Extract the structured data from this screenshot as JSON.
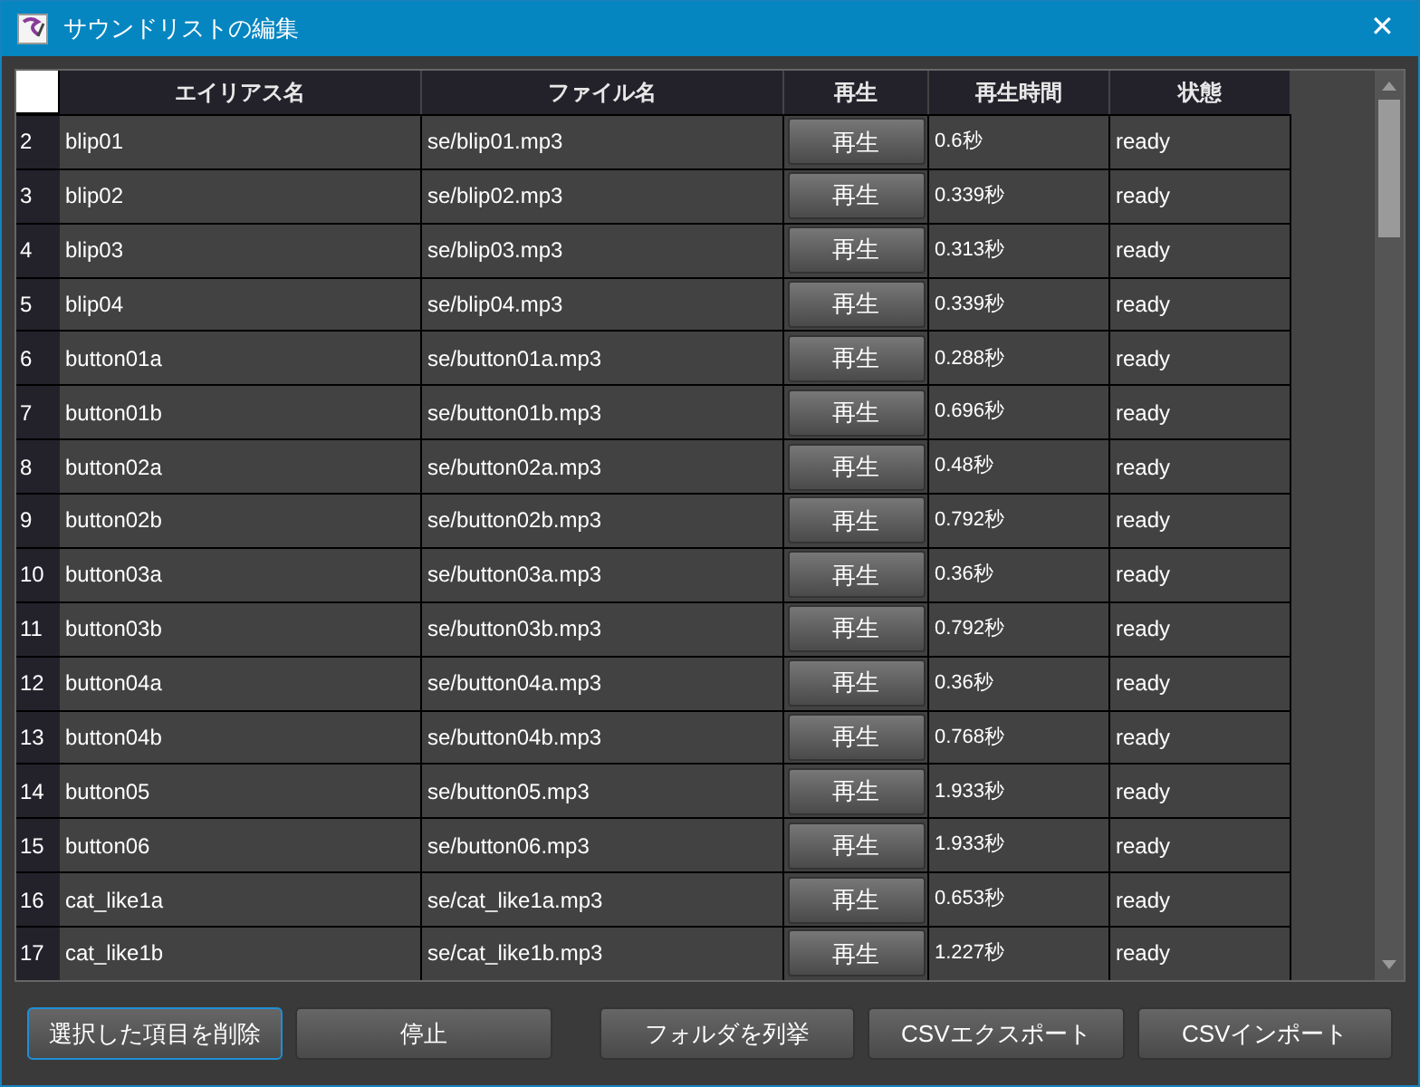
{
  "window": {
    "title": "サウンドリストの編集",
    "close": "✕"
  },
  "table": {
    "columns": [
      "エイリアス名",
      "ファイル名",
      "再生",
      "再生時間",
      "状態"
    ],
    "rows": [
      {
        "index": "2",
        "alias": "blip01",
        "file": "se/blip01.mp3",
        "play": "再生",
        "duration": "0.6秒",
        "status": "ready"
      },
      {
        "index": "3",
        "alias": "blip02",
        "file": "se/blip02.mp3",
        "play": "再生",
        "duration": "0.339秒",
        "status": "ready"
      },
      {
        "index": "4",
        "alias": "blip03",
        "file": "se/blip03.mp3",
        "play": "再生",
        "duration": "0.313秒",
        "status": "ready"
      },
      {
        "index": "5",
        "alias": "blip04",
        "file": "se/blip04.mp3",
        "play": "再生",
        "duration": "0.339秒",
        "status": "ready"
      },
      {
        "index": "6",
        "alias": "button01a",
        "file": "se/button01a.mp3",
        "play": "再生",
        "duration": "0.288秒",
        "status": "ready"
      },
      {
        "index": "7",
        "alias": "button01b",
        "file": "se/button01b.mp3",
        "play": "再生",
        "duration": "0.696秒",
        "status": "ready"
      },
      {
        "index": "8",
        "alias": "button02a",
        "file": "se/button02a.mp3",
        "play": "再生",
        "duration": "0.48秒",
        "status": "ready"
      },
      {
        "index": "9",
        "alias": "button02b",
        "file": "se/button02b.mp3",
        "play": "再生",
        "duration": "0.792秒",
        "status": "ready"
      },
      {
        "index": "10",
        "alias": "button03a",
        "file": "se/button03a.mp3",
        "play": "再生",
        "duration": "0.36秒",
        "status": "ready"
      },
      {
        "index": "11",
        "alias": "button03b",
        "file": "se/button03b.mp3",
        "play": "再生",
        "duration": "0.792秒",
        "status": "ready"
      },
      {
        "index": "12",
        "alias": "button04a",
        "file": "se/button04a.mp3",
        "play": "再生",
        "duration": "0.36秒",
        "status": "ready"
      },
      {
        "index": "13",
        "alias": "button04b",
        "file": "se/button04b.mp3",
        "play": "再生",
        "duration": "0.768秒",
        "status": "ready"
      },
      {
        "index": "14",
        "alias": "button05",
        "file": "se/button05.mp3",
        "play": "再生",
        "duration": "1.933秒",
        "status": "ready"
      },
      {
        "index": "15",
        "alias": "button06",
        "file": "se/button06.mp3",
        "play": "再生",
        "duration": "1.933秒",
        "status": "ready"
      },
      {
        "index": "16",
        "alias": "cat_like1a",
        "file": "se/cat_like1a.mp3",
        "play": "再生",
        "duration": "0.653秒",
        "status": "ready"
      },
      {
        "index": "17",
        "alias": "cat_like1b",
        "file": "se/cat_like1b.mp3",
        "play": "再生",
        "duration": "1.227秒",
        "status": "ready"
      }
    ]
  },
  "buttons": [
    {
      "label": "選択した項目を削除",
      "focused": true
    },
    {
      "label": "停止",
      "focused": false
    },
    {
      "label": "フォルダを列挙",
      "focused": false
    },
    {
      "label": "CSVエクスポート",
      "focused": false
    },
    {
      "label": "CSVインポート",
      "focused": false
    }
  ]
}
